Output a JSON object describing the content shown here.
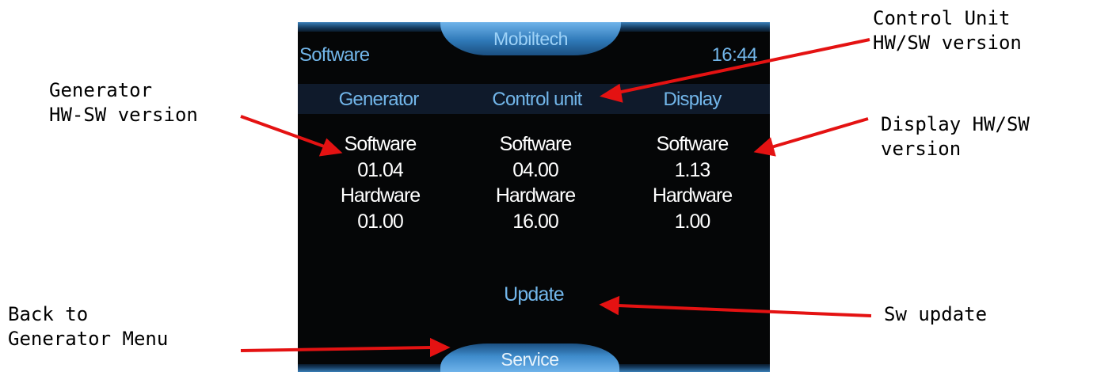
{
  "screen": {
    "title": "Software",
    "app_name": "Mobiltech",
    "clock": "16:44",
    "columns": [
      {
        "header": "Generator",
        "software_label": "Software",
        "software_value": "01.04",
        "hardware_label": "Hardware",
        "hardware_value": "01.00"
      },
      {
        "header": "Control unit",
        "software_label": "Software",
        "software_value": "04.00",
        "hardware_label": "Hardware",
        "hardware_value": "16.00"
      },
      {
        "header": "Display",
        "software_label": "Software",
        "software_value": "1.13",
        "hardware_label": "Hardware",
        "hardware_value": "1.00"
      }
    ],
    "update_label": "Update",
    "service_label": "Service"
  },
  "annotations": {
    "generator_line1": "Generator",
    "generator_line2": "HW-SW version",
    "control_line1": "Control Unit",
    "control_line2": "HW/SW version",
    "display_line1": "Display HW/SW",
    "display_line2": "version",
    "back_line1": "Back to",
    "back_line2": "Generator Menu",
    "sw_update": "Sw update"
  },
  "colors": {
    "screen_bg": "#050607",
    "accent_blue": "#72b6ea",
    "arrow_red": "#e41212"
  }
}
